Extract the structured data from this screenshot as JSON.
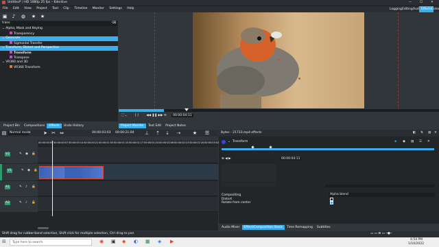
{
  "window": {
    "title": "Untitled* / HD 1080p 25 fps – Kdenlive"
  },
  "menu": [
    "File",
    "Edit",
    "View",
    "Project",
    "Tool",
    "Clip",
    "Timeline",
    "Monitor",
    "Settings",
    "Help"
  ],
  "workspaces": [
    "Logging",
    "Editing",
    "Audio",
    "Effects",
    "Color"
  ],
  "active_workspace": "Effects",
  "effects_tree": {
    "search_value": "trans",
    "items": [
      {
        "label": "Alpha, Mask and Keying",
        "type": "category"
      },
      {
        "label": "Transparency",
        "type": "effect"
      },
      {
        "label": "Generate",
        "type": "category",
        "selected": true
      },
      {
        "label": "Sigmoidal Transfer",
        "type": "effect"
      },
      {
        "label": "Transform, Distort and Perspective",
        "type": "category",
        "selected": true
      },
      {
        "label": "Transform",
        "type": "effect",
        "bold": true
      },
      {
        "label": "Transpose",
        "type": "effect"
      },
      {
        "label": "VR360 and 3D",
        "type": "category"
      },
      {
        "label": "VR360 Transform",
        "type": "effect"
      }
    ]
  },
  "left_tabs": [
    "Project Bin",
    "Compositions",
    "Effects",
    "Undo History"
  ],
  "left_active_tab": "Effects",
  "monitor_tabs": [
    "Project Monitor",
    "Text Edit",
    "Project Notes"
  ],
  "monitor_active_tab": "Project Monitor",
  "monitor_timecode": "00:00:04:11",
  "timeline": {
    "mode": "Normal mode",
    "timecode_left": "00:00:03:03",
    "timecode_right": "00:00:21:04",
    "ruler": [
      "00:00:00:00",
      "00:00:00:07",
      "00:00:00:14",
      "00:00:00:21",
      "00:00:01:03",
      "00:00:01:10",
      "00:00:01:17",
      "00:00:01:24",
      "00:00:02:06",
      "00:00:02:13",
      "00:00:02:20",
      "00:00:03:02"
    ],
    "tracks": [
      "V2",
      "V1",
      "A1",
      "A2"
    ]
  },
  "effect_stack": {
    "header": "Bytes - 21733.mp4 effects",
    "effect_name": "Transform",
    "timecode": "00:00:04:11",
    "compositing_label": "Compositing",
    "compositing_value": "Alpha blend",
    "distort_label": "Distort",
    "rotate_label": "Rotate from center"
  },
  "bottom_tabs": [
    "Audio Mixer",
    "Effect/Composition Stack",
    "Time Remapping",
    "Subtitles"
  ],
  "bottom_active_tab": "Effect/Composition Stack",
  "status": "Shift drag for rubber-band selection, Shift click for multiple selection, Ctrl drag to pan",
  "taskbar": {
    "search_placeholder": "Type here to search",
    "time": "4:54 PM",
    "date": "1/10/2022"
  },
  "colors": {
    "accent": "#3daee9",
    "panel": "#232629",
    "bg": "#31363b",
    "clip": "#3a63b8",
    "clip_border": "#e0452e"
  }
}
